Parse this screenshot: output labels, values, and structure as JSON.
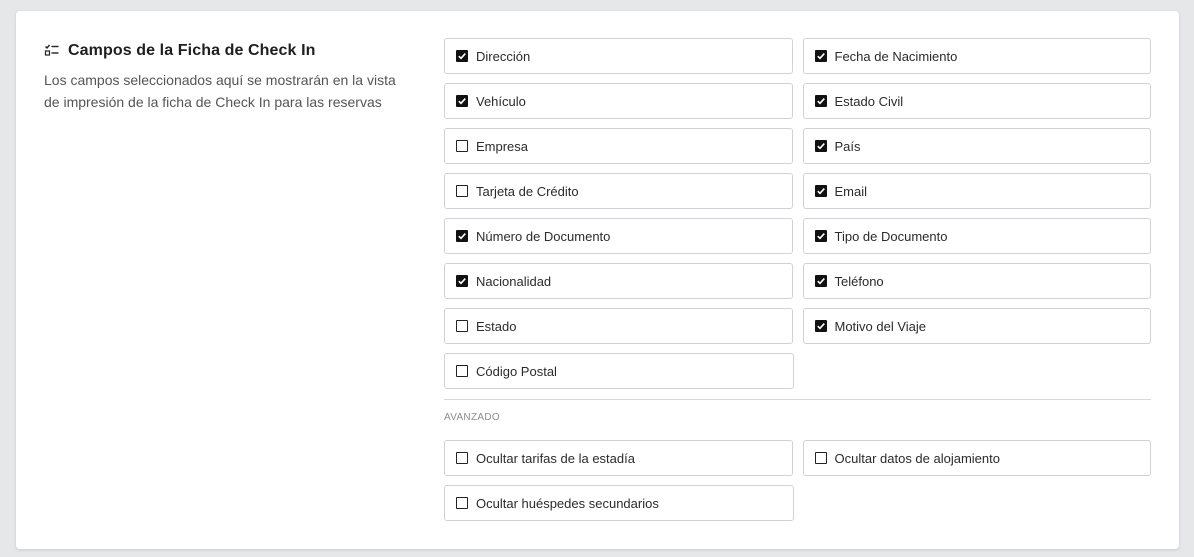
{
  "header": {
    "title": "Campos de la Ficha de Check In",
    "description": "Los campos seleccionados aquí se mostrarán en la vista de impresión de la ficha de Check In para las reservas",
    "icon": "checklist-icon"
  },
  "fields": [
    {
      "label": "Dirección",
      "checked": true
    },
    {
      "label": "Fecha de Nacimiento",
      "checked": true
    },
    {
      "label": "Vehículo",
      "checked": true
    },
    {
      "label": "Estado Civil",
      "checked": true
    },
    {
      "label": "Empresa",
      "checked": false
    },
    {
      "label": "País",
      "checked": true
    },
    {
      "label": "Tarjeta de Crédito",
      "checked": false
    },
    {
      "label": "Email",
      "checked": true
    },
    {
      "label": "Número de Documento",
      "checked": true
    },
    {
      "label": "Tipo de Documento",
      "checked": true
    },
    {
      "label": "Nacionalidad",
      "checked": true
    },
    {
      "label": "Teléfono",
      "checked": true
    },
    {
      "label": "Estado",
      "checked": false
    },
    {
      "label": "Motivo del Viaje",
      "checked": true
    },
    {
      "label": "Código Postal",
      "checked": false
    }
  ],
  "advanced": {
    "label": "AVANZADO",
    "fields": [
      {
        "label": "Ocultar tarifas de la estadía",
        "checked": false
      },
      {
        "label": "Ocultar datos de alojamiento",
        "checked": false
      },
      {
        "label": "Ocultar huéspedes secundarios",
        "checked": false
      }
    ]
  },
  "colors": {
    "background": "#e6e7e9",
    "card": "#ffffff",
    "border": "#cfd2d6",
    "checkbox": "#111111"
  }
}
